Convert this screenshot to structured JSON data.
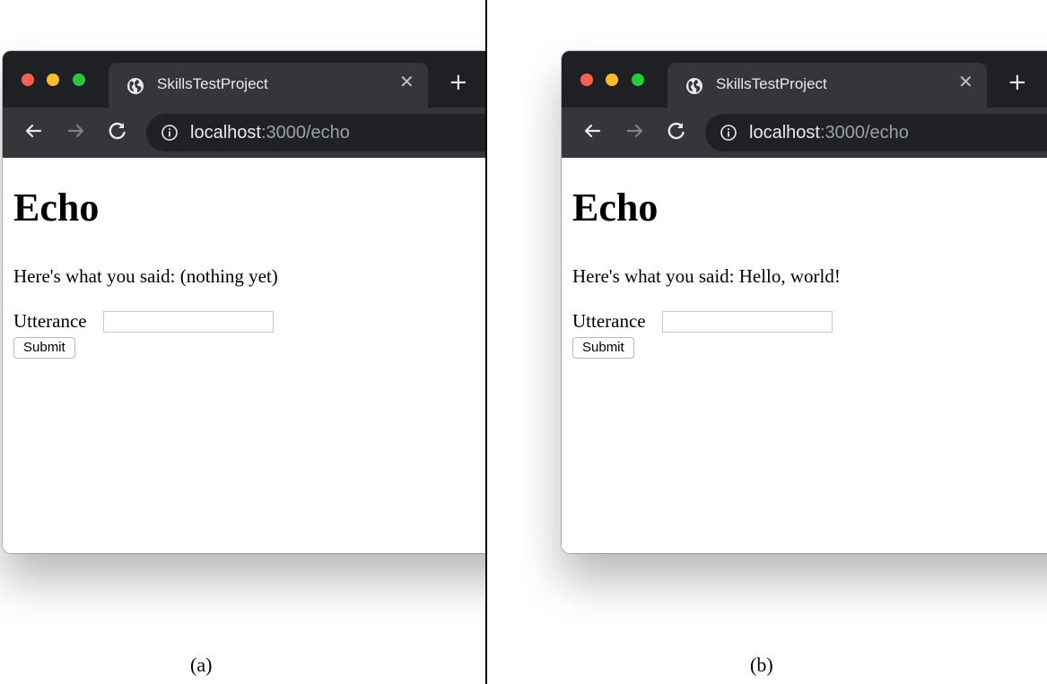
{
  "panels": [
    {
      "caption": "(a)",
      "browser": {
        "tab_title": "SkillsTestProject",
        "url_host": "localhost",
        "url_rest": ":3000/echo"
      },
      "page": {
        "heading": "Echo",
        "said_text": "Here's what you said: (nothing yet)",
        "utterance_label": "Utterance",
        "utterance_value": "",
        "submit_label": "Submit"
      }
    },
    {
      "caption": "(b)",
      "browser": {
        "tab_title": "SkillsTestProject",
        "url_host": "localhost",
        "url_rest": ":3000/echo"
      },
      "page": {
        "heading": "Echo",
        "said_text": "Here's what you said: Hello, world!",
        "utterance_label": "Utterance",
        "utterance_value": "",
        "submit_label": "Submit"
      }
    }
  ],
  "icons": {
    "tab_favicon": "globe-icon",
    "tab_close": "close-icon",
    "new_tab": "plus-icon",
    "back": "arrow-left-icon",
    "forward": "arrow-right-icon",
    "reload": "reload-icon",
    "site_info": "info-icon"
  },
  "colors": {
    "titlebar": "#1f2023",
    "toolbar": "#35363a",
    "omnibox": "#202124",
    "close_light": "#fe5f57",
    "minimize_light": "#febc2e",
    "zoom_light": "#28c840"
  }
}
